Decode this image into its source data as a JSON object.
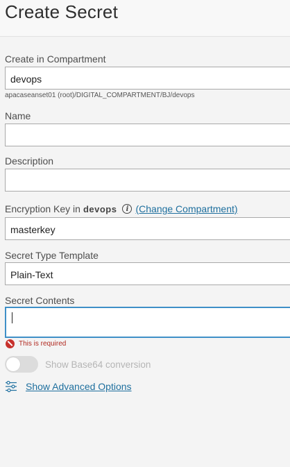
{
  "header": {
    "title": "Create Secret"
  },
  "compartment": {
    "label": "Create in Compartment",
    "value": "devops",
    "path_hint": "apacaseanset01 (root)/DIGITAL_COMPARTMENT/BJ/devops"
  },
  "name": {
    "label": "Name",
    "value": ""
  },
  "description": {
    "label": "Description",
    "value": ""
  },
  "encryption": {
    "label_prefix": "Encryption Key in",
    "compartment": "devops",
    "change_link": "(Change Compartment)",
    "value": "masterkey"
  },
  "secret_type": {
    "label": "Secret Type Template",
    "value": "Plain-Text"
  },
  "secret_contents": {
    "label": "Secret Contents",
    "value": "",
    "error": "This is required"
  },
  "base64_toggle": {
    "label": "Show Base64 conversion",
    "enabled": false
  },
  "advanced": {
    "link": "Show Advanced Options"
  },
  "colors": {
    "link": "#1e6f9e",
    "focus_border": "#3e8fc7",
    "error": "#c7312c"
  }
}
